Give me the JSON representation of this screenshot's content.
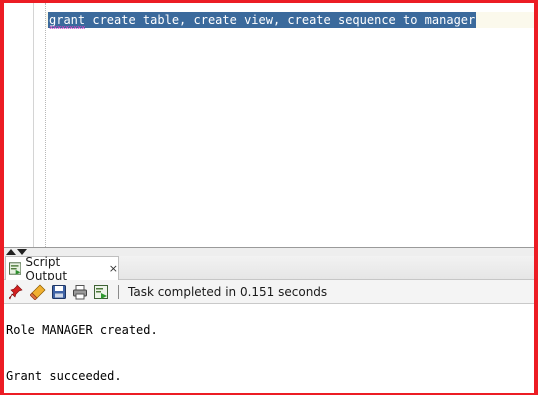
{
  "editor": {
    "code_line": "grant create table, create view, create sequence to manager"
  },
  "panel": {
    "tab_label": "Script Output",
    "tab_close": "×"
  },
  "toolbar": {
    "buttons": [
      "pin-icon",
      "eraser-icon",
      "save-icon",
      "print-icon",
      "run-script-icon"
    ],
    "status": "Task completed in 0.151 seconds"
  },
  "output": {
    "lines": [
      "Role MANAGER created.",
      "Grant succeeded."
    ]
  },
  "colors": {
    "frame": "#ec1c24",
    "selection": "#3b6a9c",
    "current_line": "#fbf9ec"
  }
}
